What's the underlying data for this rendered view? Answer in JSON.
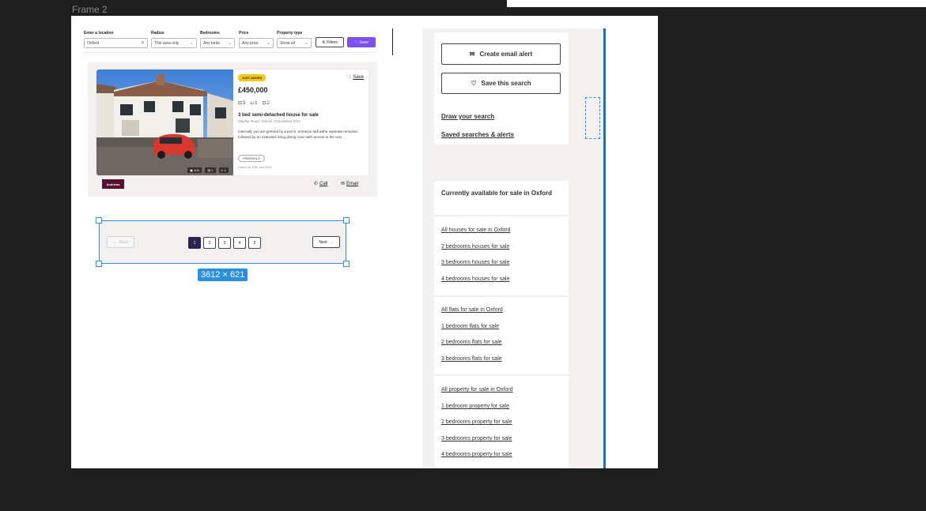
{
  "canvas": {
    "frame_label": "Frame 2",
    "selection_dimensions": "3612 × 621"
  },
  "search": {
    "location_label": "Enter a location",
    "location_value": "Oxford",
    "radius_label": "Radius",
    "radius_value": "This area only",
    "bedrooms_label": "Bedrooms",
    "bedrooms_value": "Any beds",
    "price_label": "Price",
    "price_value": "Any price",
    "type_label": "Property type",
    "type_value": "Show all",
    "filters_label": "Filters",
    "save_label": "Save"
  },
  "listing": {
    "badge": "JUST ADDED",
    "save_label": "Save",
    "price": "£450,000",
    "beds": "3",
    "baths": "1",
    "receptions": "2",
    "title": "3 bed semi-detached house for sale",
    "address": "Mayfair Road, Oxford, Oxfordshire OX4",
    "description": "Internally you are greeted by a porch, entrance hall withe seperate reception followed by an extended living dining room with access to the rear ...",
    "tenure": "FREEHOLD",
    "listed": "Listed on 13th Jan 2024",
    "photos_count": "1/11",
    "floorplan_count": "1",
    "video_count": "1",
    "agent": "Andrews",
    "call_label": "Call",
    "email_label": "Email"
  },
  "pagination": {
    "back_label": "Back",
    "pages": [
      "1",
      "2",
      "3",
      "4",
      "5"
    ],
    "next_label": "Next"
  },
  "sidebar": {
    "create_alert_label": "Create email alert",
    "save_search_label": "Save this search",
    "draw_search_label": "Draw your search",
    "saved_searches_label": "Saved searches & alerts",
    "heading": "Currently available for sale in Oxford",
    "houses": [
      "All houses for sale in Oxford",
      "2 bedrooms houses for sale",
      "3 bedrooms houses for sale",
      "4 bedrooms houses for sale"
    ],
    "flats": [
      "All flats for sale in Oxford",
      "1 bedroom flats for sale",
      "2 bedrooms flats for sale",
      "3 bedrooms flats for sale"
    ],
    "property": [
      "All property for sale in Oxford",
      "1 bedroom property for sale",
      "2 bedrooms property for sale",
      "3 bedrooms property for sale",
      "4 bedrooms property for sale"
    ]
  },
  "colors": {
    "accent_purple": "#7b4ff0",
    "selection_blue": "#2a8fe0",
    "badge_yellow": "#f5c518",
    "active_page": "#2b2350",
    "agent_brand": "#5a1033"
  }
}
